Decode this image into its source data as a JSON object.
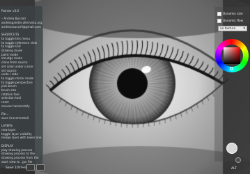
{
  "app": {
    "title": "Painter v3.0"
  },
  "left_panel": {
    "lines": [
      "Painter v3.0",
      "",
      "– Andrea Bucceli",
      "andreapainter.altervista.org",
      "andrea.bucceli@gmail.com",
      "",
      "SHORTCUTS",
      "to toggle this menu",
      "to toggle reference view",
      "to toggle GUI",
      "drawing mode",
      "paint mode",
      "smudge mode",
      "clone from source",
      "set color under cursor",
      "set source",
      "undo / redo",
      "to toggle mirror mode",
      "to toggle perspective",
      "pick brush",
      "brush size",
      "rotation tool",
      "selection tool",
      "reset",
      "canvas horizontally",
      "",
      "file...",
      "save (incremental)",
      "",
      "LAYERS",
      "new layer",
      "toggle layer visibility",
      "merge layer with lower one",
      "",
      "DISPLAY",
      "play drawing process",
      "drawing process to the",
      "drawing process from the",
      "start view to ..jpn file"
    ],
    "status_line": "Save: [ctrl+s]"
  },
  "right_panel": {
    "dynamic_size_label": "Dynamic size",
    "dynamic_flow_label": "Dynamic flow",
    "texture_select_value": "no texture",
    "hue_color": "#ff0000",
    "bottom_label": "ALT"
  }
}
